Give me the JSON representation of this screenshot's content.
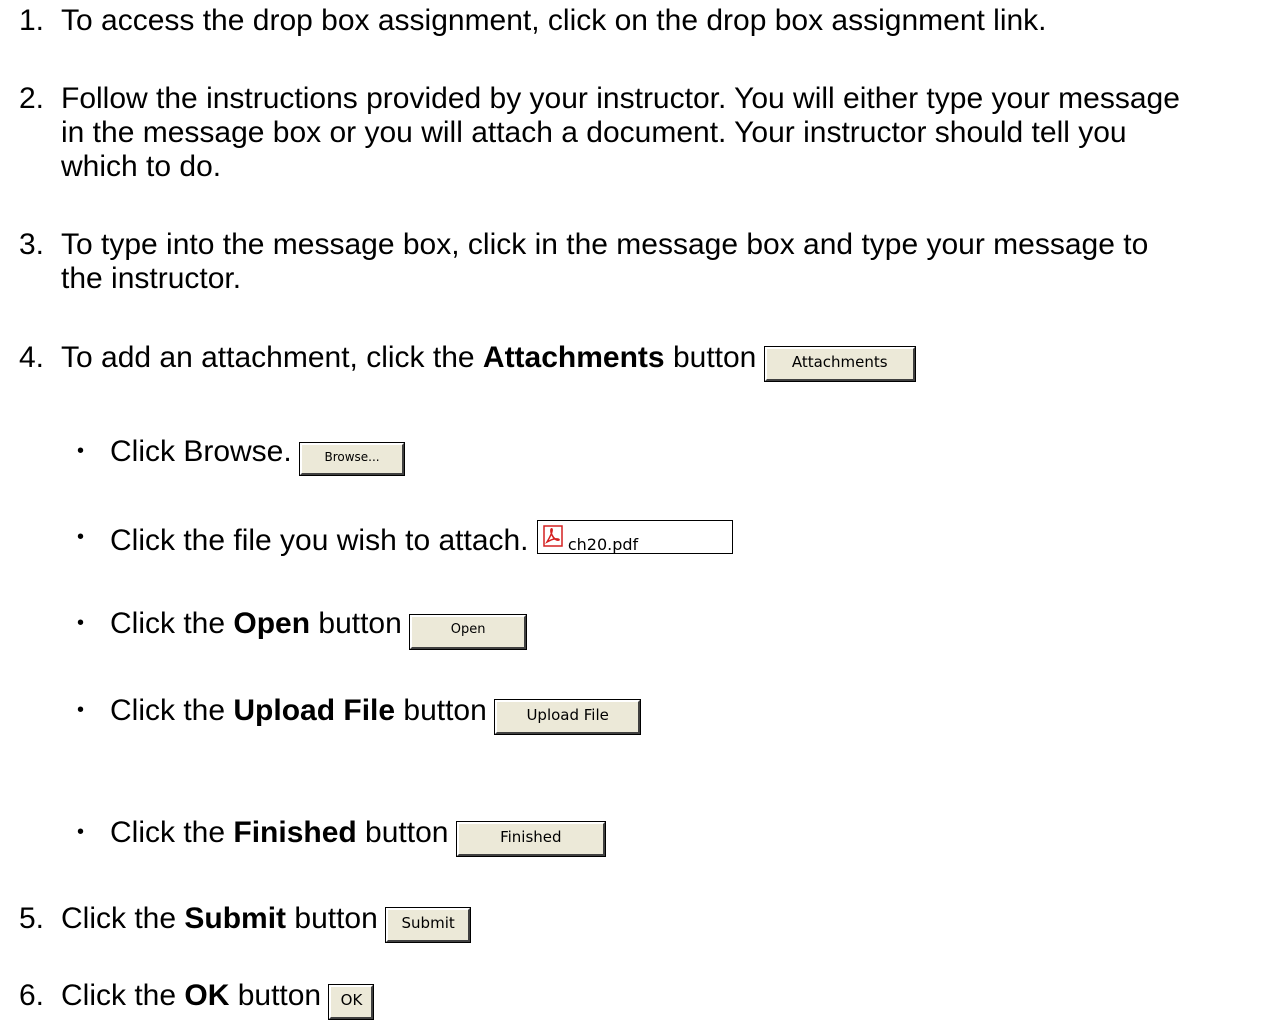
{
  "steps": [
    {
      "num": "1.",
      "lines": [
        "To access the drop box assignment, click on the drop box assignment link."
      ]
    },
    {
      "num": "2.",
      "lines": [
        "Follow the instructions provided by your instructor. You will either type your message",
        "in the message box or you will attach a document. Your instructor should tell you",
        "which to do."
      ]
    },
    {
      "num": "3.",
      "lines": [
        "To type into the message box, click in the message box and type your message to",
        "the instructor."
      ]
    },
    {
      "num": "4.",
      "prefix": "To add an attachment, click the ",
      "bold": "Attachments",
      "suffix": " button",
      "button": "Attachments"
    },
    {
      "num": "5.",
      "prefix": "Click the ",
      "bold": "Submit",
      "suffix": " button",
      "button": "Submit"
    },
    {
      "num": "6.",
      "prefix": "Click the  ",
      "bold": "OK",
      "suffix": "  button",
      "button": "OK"
    }
  ],
  "substeps": [
    {
      "text": "Click Browse. ",
      "button": "Browse..."
    },
    {
      "text": "Click the file you wish to attach. ",
      "file": "ch20.pdf",
      "icon": "pdf-file-icon"
    },
    {
      "prefix": "Click the ",
      "bold": "Open",
      "suffix": " button",
      "button": "Open"
    },
    {
      "prefix": "Click the ",
      "bold": "Upload File",
      "suffix": " button",
      "button": "Upload File"
    },
    {
      "prefix": "Click the ",
      "bold": "Finished",
      "suffix": " button",
      "button": "Finished"
    }
  ],
  "bullet": "•",
  "colors": {
    "button_face": "#ece9d8",
    "text": "#000000",
    "pdf_red": "#d42020"
  }
}
